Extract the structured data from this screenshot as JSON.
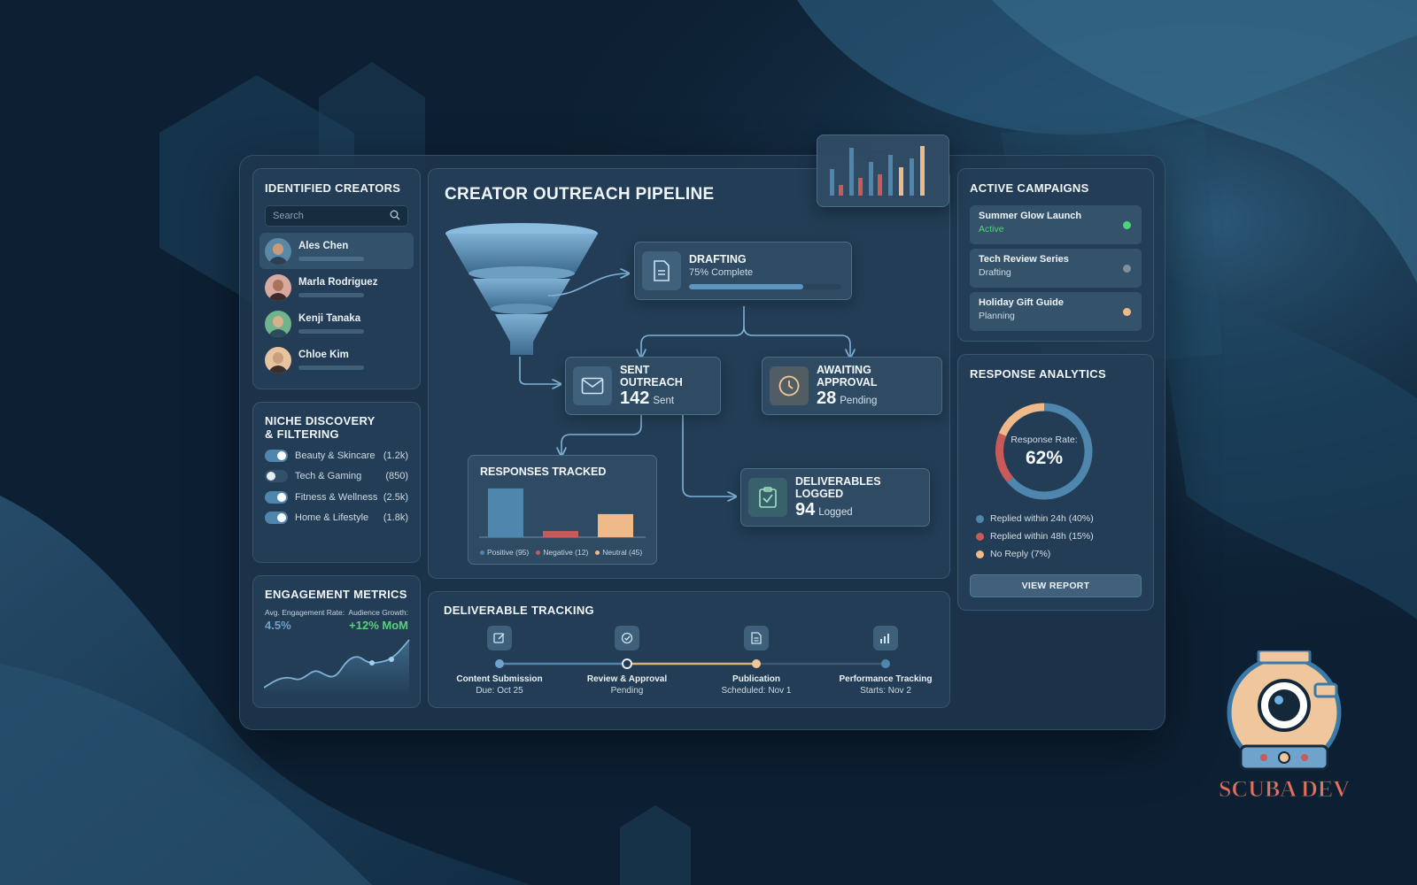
{
  "creators": {
    "title": "Identified Creators",
    "search_placeholder": "Search",
    "items": [
      {
        "name": "Ales Chen"
      },
      {
        "name": "Marla Rodriguez"
      },
      {
        "name": "Kenji Tanaka"
      },
      {
        "name": "Chloe Kim"
      }
    ]
  },
  "niche": {
    "title_line1": "Niche Discovery",
    "title_line2": "& Filtering",
    "items": [
      {
        "label": "Beauty & Skincare",
        "count": "(1.2k)",
        "enabled": true
      },
      {
        "label": "Tech & Gaming",
        "count": "(850)",
        "enabled": false
      },
      {
        "label": "Fitness & Wellness",
        "count": "(2.5k)",
        "enabled": true
      },
      {
        "label": "Home & Lifestyle",
        "count": "(1.8k)",
        "enabled": true
      }
    ]
  },
  "engagement": {
    "title": "Engagement Metrics",
    "rate_label": "Avg. Engagement Rate:",
    "rate_value": "4.5%",
    "growth_label": "Audience Growth:",
    "growth_value": "+12% MoM"
  },
  "pipeline": {
    "title": "Creator Outreach Pipeline",
    "drafting": {
      "title": "Drafting",
      "sub": "75% Complete",
      "progress": 0.75
    },
    "sent": {
      "title": "Sent Outreach",
      "count": "142",
      "unit": "Sent"
    },
    "approval": {
      "title": "Awaiting Approval",
      "count": "28",
      "unit": "Pending"
    },
    "deliverables": {
      "title": "Deliverables Logged",
      "count": "94",
      "unit": "Logged"
    },
    "responses": {
      "title": "Responses Tracked",
      "legend": [
        {
          "label": "Positive (95)",
          "value": 95,
          "color": "#4f86ad"
        },
        {
          "label": "Negative (12)",
          "value": 12,
          "color": "#c85a5a"
        },
        {
          "label": "Neutral (45)",
          "value": 45,
          "color": "#f0b98a"
        }
      ]
    }
  },
  "tracking": {
    "title": "Deliverable Tracking",
    "milestones": [
      {
        "title": "Content Submission",
        "sub": "Due: Oct 25"
      },
      {
        "title": "Review & Approval",
        "sub": "Pending"
      },
      {
        "title": "Publication",
        "sub": "Scheduled: Nov 1"
      },
      {
        "title": "Performance Tracking",
        "sub": "Starts: Nov 2"
      }
    ]
  },
  "campaigns": {
    "title": "Active Campaigns",
    "items": [
      {
        "name": "Summer Glow Launch",
        "status": "Active",
        "color": "#4fd27a"
      },
      {
        "name": "Tech Review Series",
        "status": "Drafting",
        "color": "#7f8e9b"
      },
      {
        "name": "Holiday Gift Guide",
        "status": "Planning",
        "color": "#f0b98a"
      }
    ]
  },
  "analytics": {
    "title": "Response Analytics",
    "rate_label": "Response Rate:",
    "rate_value": "62%",
    "legend": [
      {
        "label": "Replied within 24h (40%)",
        "color": "#4f86ad"
      },
      {
        "label": "Replied within 48h (15%)",
        "color": "#c85a5a"
      },
      {
        "label": "No Reply (7%)",
        "color": "#f0b98a"
      }
    ],
    "button": "View Report"
  },
  "logo": {
    "text": "SCUBA DEV"
  }
}
